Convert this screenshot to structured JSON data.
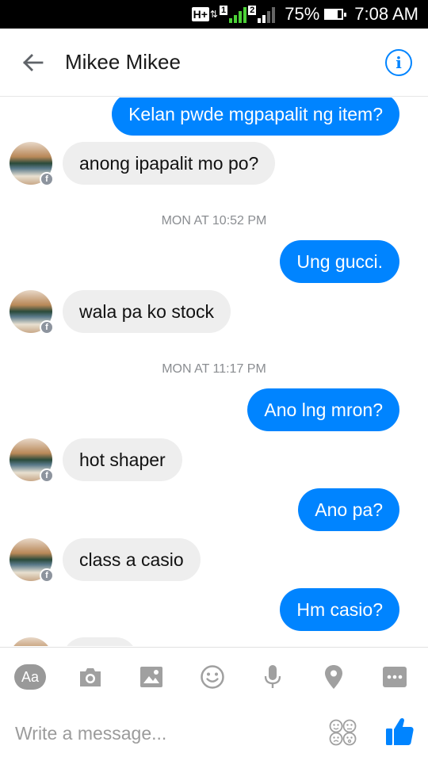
{
  "status_bar": {
    "network": "H+",
    "sim1_badge": "1",
    "sim2_badge": "2",
    "battery": "75%",
    "time": "7:08 AM"
  },
  "header": {
    "title": "Mikee Mikee",
    "back_icon": "arrow-left-icon",
    "info_icon": "info-icon",
    "info_glyph": "i"
  },
  "messages": [
    {
      "side": "out",
      "text": "Kelan pwde mgpapalit ng item?"
    },
    {
      "side": "in",
      "text": "anong ipapalit mo po?"
    },
    {
      "type": "timestamp",
      "text": "MON AT 10:52 PM"
    },
    {
      "side": "out",
      "text": "Ung gucci."
    },
    {
      "side": "in",
      "text": "wala pa ko stock"
    },
    {
      "type": "timestamp",
      "text": "MON AT 11:17 PM"
    },
    {
      "side": "out",
      "text": "Ano lng mron?"
    },
    {
      "side": "in",
      "text": "hot shaper"
    },
    {
      "side": "out",
      "text": "Ano pa?"
    },
    {
      "side": "in",
      "text": "class a casio"
    },
    {
      "side": "out",
      "text": "Hm casio?"
    }
  ],
  "toolbar": {
    "aa_label": "Aa",
    "icons": [
      "text-format-icon",
      "camera-icon",
      "image-icon",
      "emoji-icon",
      "microphone-icon",
      "location-icon",
      "more-icon"
    ]
  },
  "composer": {
    "placeholder": "Write a message...",
    "emoji_icon": "stickers-icon",
    "like_icon": "thumbs-up-icon"
  },
  "colors": {
    "accent": "#0084ff",
    "incoming_bubble": "#eeeeee",
    "icon_gray": "#a0a0a0"
  }
}
